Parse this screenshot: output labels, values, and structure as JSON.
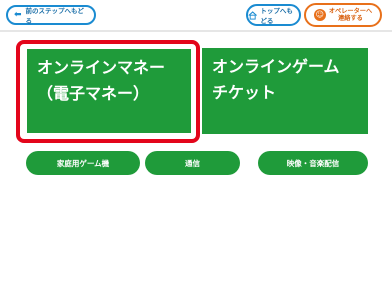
{
  "header": {
    "back_label": "前のステップへもどる",
    "top_label": "トップへもどる",
    "operator_line1": "オペレーターへ",
    "operator_line2": "連絡する"
  },
  "tiles": [
    {
      "line1": "オンラインマネー",
      "line2": "（電子マネー）",
      "selected": true
    },
    {
      "line1": "オンラインゲーム",
      "line2": "チケット",
      "selected": false
    }
  ],
  "categories": [
    "家庭用ゲーム機",
    "通信",
    "映像・音楽配信"
  ],
  "colors": {
    "tile_green": "#1f9b3a",
    "selection_red": "#e3051b",
    "nav_blue": "#1a8bd1",
    "operator_orange": "#e8701a"
  },
  "icons": {
    "back": "arrow-left-icon",
    "top": "home-icon",
    "operator": "headset-icon"
  }
}
